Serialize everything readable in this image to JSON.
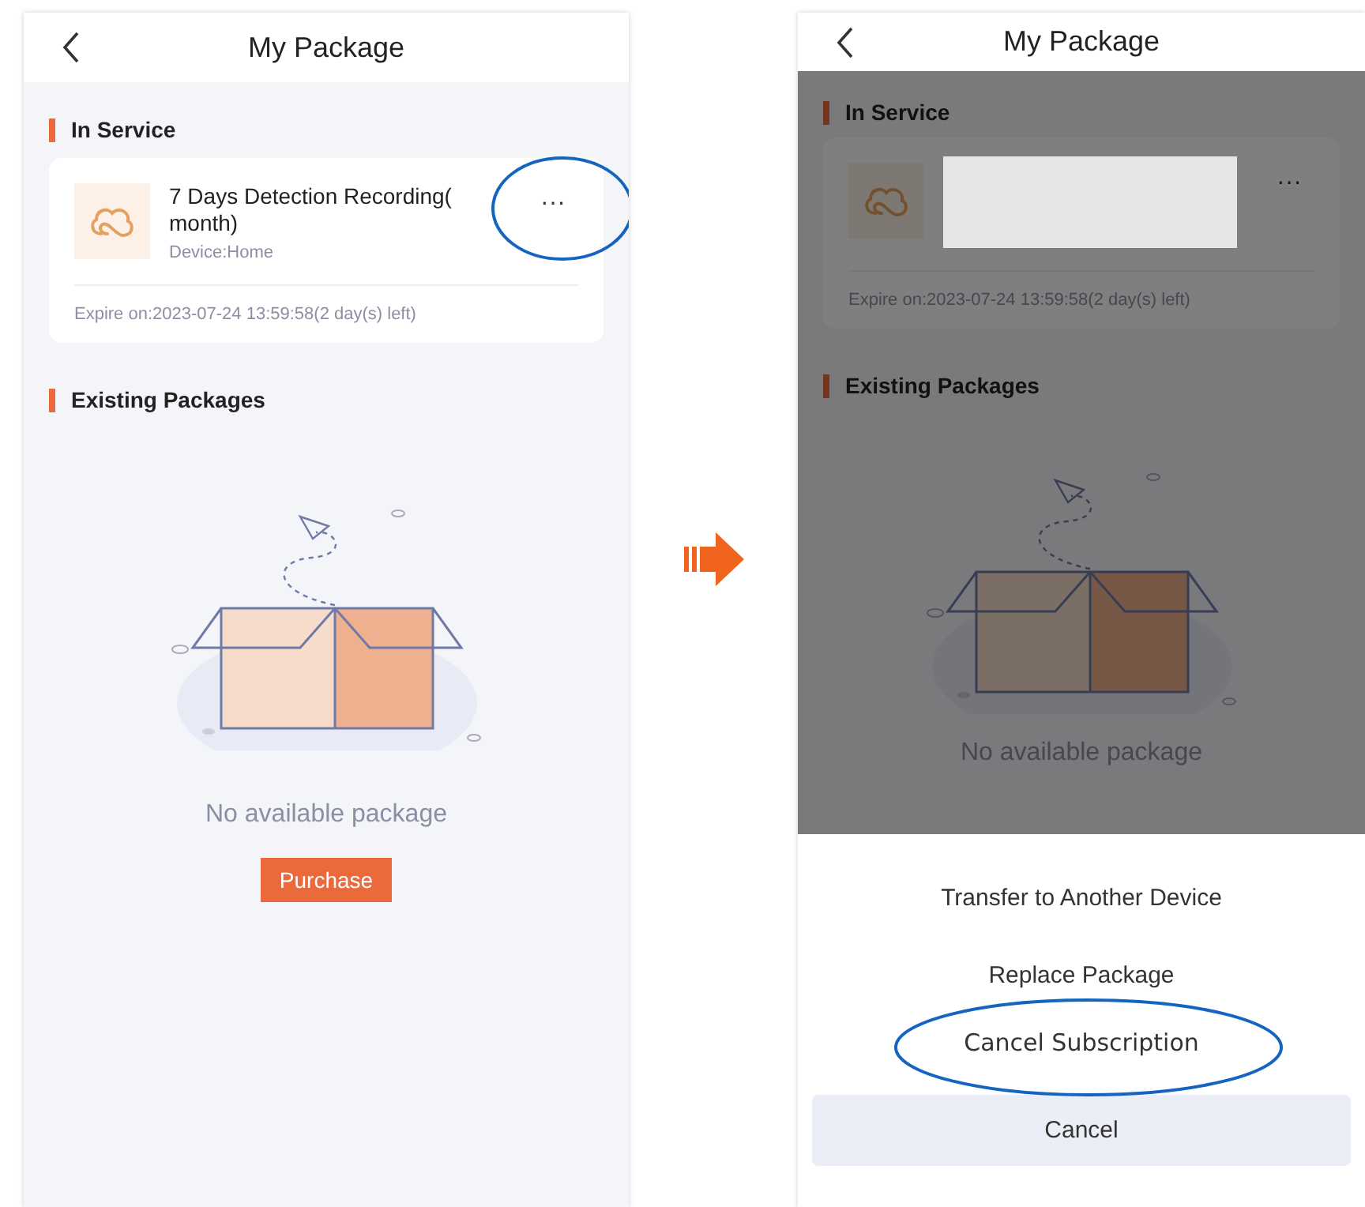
{
  "screens": [
    {
      "title": "My Package",
      "dimmed": false,
      "in_service_heading": "In Service",
      "package": {
        "redacted": false,
        "name": "7 Days Detection Recording(",
        "name_line2": "month)",
        "device": "Device:Home",
        "more": "···",
        "more_circled": true,
        "expire": "Expire on:2023-07-24 13:59:58(2 day(s) left)"
      },
      "existing_heading": "Existing Packages",
      "empty_text": "No available package",
      "purchase": "Purchase"
    },
    {
      "title": "My Package",
      "dimmed": true,
      "in_service_heading": "In Service",
      "package": {
        "redacted": true,
        "more": "···",
        "more_circled": false,
        "expire": "Expire on:2023-07-24 13:59:58(2 day(s) left)"
      },
      "existing_heading": "Existing Packages",
      "empty_text": "No available package",
      "sheet": {
        "options": [
          {
            "label": "Transfer to Another Device",
            "circled": false
          },
          {
            "label": "Replace Package",
            "circled": false
          },
          {
            "label": "Cancel Subscription",
            "circled": true
          }
        ],
        "cancel": "Cancel"
      }
    }
  ]
}
